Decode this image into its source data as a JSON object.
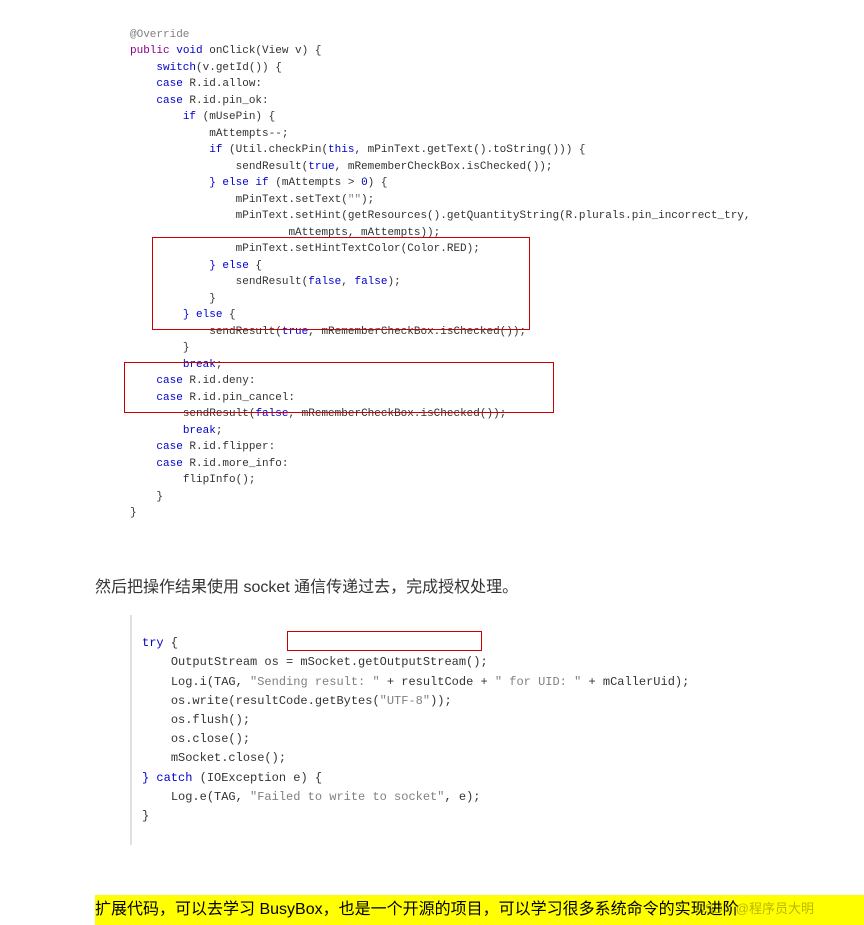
{
  "code1": {
    "annotation": "@Override",
    "line1_kw1": "public",
    "line1_kw2": "void",
    "line1_rest": " onClick(View v) {",
    "line2_kw": "switch",
    "line2_rest": "(v.getId()) {",
    "line3_kw": "case",
    "line3_rest": " R.id.allow:",
    "line4_kw": "case",
    "line4_rest": " R.id.pin_ok:",
    "line5_kw": "if",
    "line5_rest": " (mUsePin) {",
    "line6": "mAttempts--;",
    "line7_kw1": "if",
    "line7_rest1": " (Util.checkPin(",
    "line7_kw2": "this",
    "line7_rest2": ", mPinText.getText().toString())) {",
    "line8_rest1": "sendResult(",
    "line8_kw1": "true",
    "line8_rest2": ", mRememberCheckBox.isChecked());",
    "line9_kw1": "} else if",
    "line9_rest1": " (mAttempts > ",
    "line9_num": "0",
    "line9_rest2": ") {",
    "line10_rest1": "mPinText.setText(",
    "line10_str": "\"\"",
    "line10_rest2": ");",
    "line11": "mPinText.setHint(getResources().getQuantityString(R.plurals.pin_incorrect_try,",
    "line12": "mAttempts, mAttempts));",
    "line13": "mPinText.setHintTextColor(Color.RED);",
    "line14_kw": "} else",
    "line14_rest": " {",
    "line15_rest1": "sendResult(",
    "line15_kw1": "false",
    "line15_rest2": ", ",
    "line15_kw2": "false",
    "line15_rest3": ");",
    "line16": "}",
    "line17_kw": "} else",
    "line17_rest": " {",
    "line18_rest1": "sendResult(",
    "line18_kw1": "true",
    "line18_rest2": ", mRememberCheckBox.isChecked());",
    "line19": "}",
    "line20_kw": "break",
    "line20_rest": ";",
    "line21_kw": "case",
    "line21_rest": " R.id.deny:",
    "line22_kw": "case",
    "line22_rest": " R.id.pin_cancel:",
    "line23_rest1": "sendResult(",
    "line23_kw1": "false",
    "line23_rest2": ", mRememberCheckBox.isChecked());",
    "line24_kw": "break",
    "line24_rest": ";",
    "line25_kw": "case",
    "line25_rest": " R.id.flipper:",
    "line26_kw": "case",
    "line26_rest": " R.id.more_info:",
    "line27": "flipInfo();",
    "line28": "}",
    "line29": "}"
  },
  "paragraph1": "然后把操作结果使用 socket 通信传递过去，完成授权处理。",
  "code2": {
    "line1_kw": "try",
    "line1_rest": " {",
    "line2": "OutputStream os = mSocket.getOutputStream();",
    "line3_rest1": "Log.i(TAG, ",
    "line3_str1": "\"Sending result: \"",
    "line3_rest2": " + resultCode + ",
    "line3_str2": "\" for UID: \"",
    "line3_rest3": " + mCallerUid);",
    "line4_rest1": "os.write(resultCode.getBytes(",
    "line4_str": "\"UTF-8\"",
    "line4_rest2": "));",
    "line5": "os.flush();",
    "line6": "os.close();",
    "line7": "mSocket.close();",
    "line8_kw1": "} catch",
    "line8_rest1": " (IOException e) {",
    "line9_rest1": "Log.e(TAG, ",
    "line9_str": "\"Failed to write to socket\"",
    "line9_rest2": ", e);",
    "line10": "}"
  },
  "highlight_text": "扩展代码，可以去学习 BusyBox，也是一个开源的项目，可以学习很多系统命令的实现进阶",
  "watermark": "CSDN @程序员大明"
}
